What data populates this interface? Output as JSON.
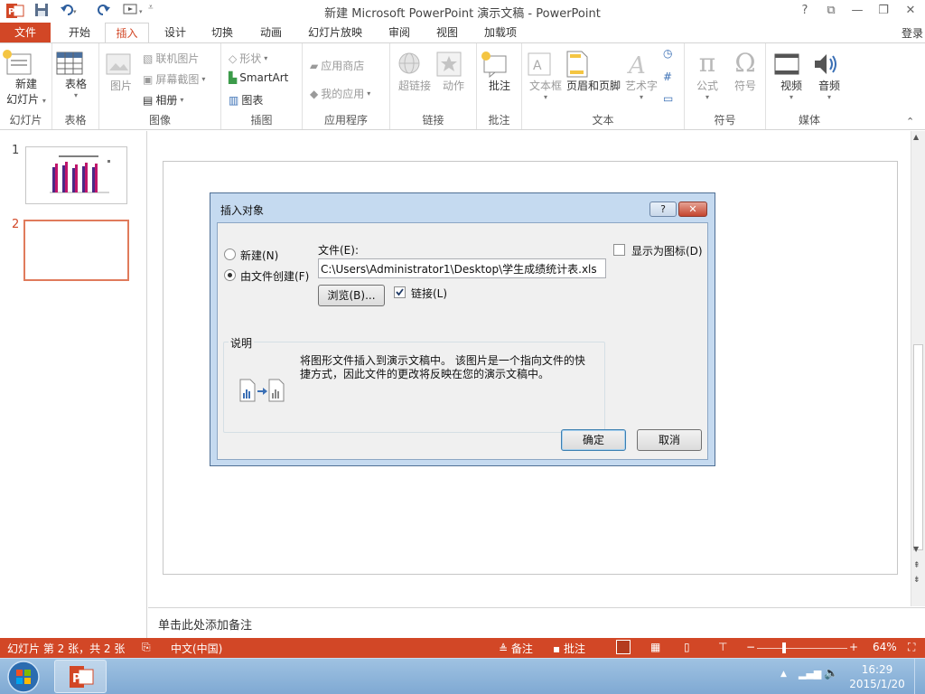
{
  "window": {
    "title": "新建 Microsoft PowerPoint 演示文稿 - PowerPoint",
    "controls": [
      "?",
      "⧉",
      "—",
      "❐",
      "✕"
    ]
  },
  "tabs": {
    "file": "文件",
    "items": [
      "开始",
      "插入",
      "设计",
      "切换",
      "动画",
      "幻灯片放映",
      "审阅",
      "视图",
      "加载项"
    ],
    "active": "插入",
    "login": "登录"
  },
  "ribbon": {
    "groups": {
      "slides": "幻灯片",
      "tables": "表格",
      "images": "图像",
      "illustrations": "插图",
      "apps": "应用程序",
      "links": "链接",
      "comments": "批注",
      "text": "文本",
      "symbols": "符号",
      "media": "媒体"
    },
    "new_slide_line1": "新建",
    "new_slide_line2": "幻灯片",
    "table": "表格",
    "picture": "图片",
    "online_picture": "联机图片",
    "screenshot": "屏幕截图",
    "album": "相册",
    "shapes": "形状",
    "smartart": "SmartArt",
    "chart": "图表",
    "store": "应用商店",
    "my_apps": "我的应用",
    "hyperlink": "超链接",
    "action": "动作",
    "comment": "批注",
    "textbox": "文本框",
    "header_footer": "页眉和页脚",
    "wordart": "艺术字",
    "equation": "公式",
    "symbol": "符号",
    "video": "视频",
    "audio": "音频"
  },
  "thumbnails": [
    {
      "number": "1"
    },
    {
      "number": "2"
    }
  ],
  "notes_placeholder": "单击此处添加备注",
  "status": {
    "slide_info": "幻灯片 第 2 张，共 2 张",
    "language": "中文(中国)",
    "notes": "备注",
    "comments": "批注",
    "zoom": "64%"
  },
  "taskbar": {
    "time": "16:29",
    "date": "2015/1/20"
  },
  "dialog": {
    "title": "插入对象",
    "help": "?",
    "close": "✕",
    "radio_new": "新建(N)",
    "radio_from_file": "由文件创建(F)",
    "file_label": "文件(E):",
    "file_path": "C:\\Users\\Administrator1\\Desktop\\学生成绩统计表.xls",
    "browse": "浏览(B)...",
    "link": "链接(L)",
    "display_as_icon": "显示为图标(D)",
    "desc_title": "说明",
    "desc_line1": "将图形文件插入到演示文稿中。 该图片是一个指向文件的快",
    "desc_line2": "捷方式，因此文件的更改将反映在您的演示文稿中。",
    "ok": "确定",
    "cancel": "取消",
    "selected_radio": "from_file",
    "link_checked": true,
    "display_as_icon_checked": false
  },
  "colors": {
    "accent": "#d24726",
    "dialog_frame": "#c5daf0",
    "taskbar": "#8fb6db"
  }
}
